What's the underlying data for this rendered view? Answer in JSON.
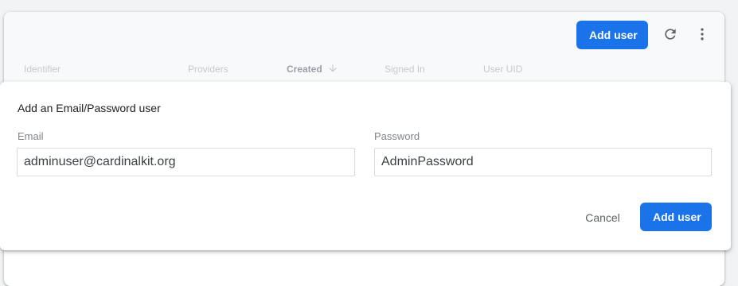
{
  "toolbar": {
    "add_user_label": "Add user",
    "refresh_icon": "refresh-icon",
    "more_icon": "more-vert-icon"
  },
  "table": {
    "columns": [
      "Identifier",
      "Providers",
      "Created",
      "Signed In",
      "User UID"
    ],
    "sorted_column": "Created",
    "sort_direction": "descending"
  },
  "dialog": {
    "title": "Add an Email/Password user",
    "email": {
      "label": "Email",
      "value": "adminuser@cardinalkit.org"
    },
    "password": {
      "label": "Password",
      "value": "AdminPassword"
    },
    "cancel_label": "Cancel",
    "submit_label": "Add user"
  },
  "colors": {
    "primary": "#1a73e8",
    "page_background": "#f1f3f4",
    "toolbar_background": "#f8f9fa"
  }
}
